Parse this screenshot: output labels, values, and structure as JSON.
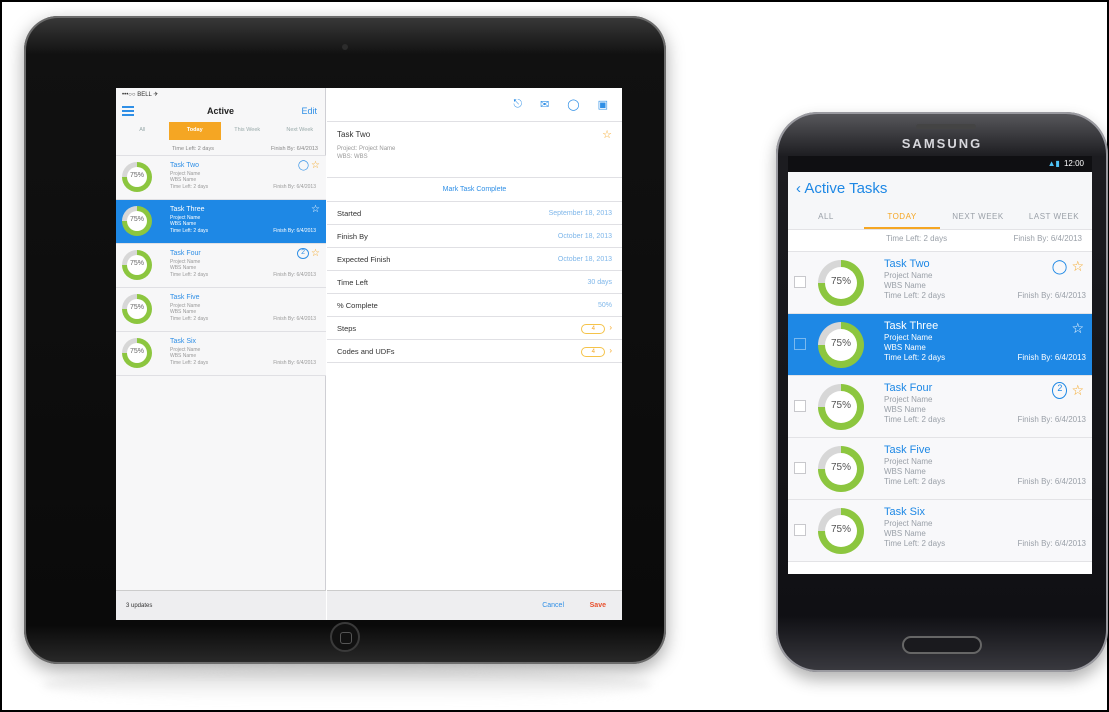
{
  "tablet": {
    "status": "•••○○ BELL ✈",
    "nav_title": "Active",
    "edit_label": "Edit",
    "tabs": [
      "All",
      "Today",
      "This Week",
      "Next Week"
    ],
    "partial_row": {
      "time_left": "Time Left: 2 days",
      "finish_by": "Finish By: 6/4/2013"
    },
    "tasks": [
      {
        "title": "Task Two",
        "project": "Project Name",
        "wbs": "WBS Name",
        "time_left": "Time Left: 2 days",
        "finish_by": "Finish By: 6/4/2013",
        "percent": "75%",
        "badge": "",
        "selected": false
      },
      {
        "title": "Task Three",
        "project": "Project Name",
        "wbs": "WBS Name",
        "time_left": "Time Left: 2 days",
        "finish_by": "Finish By: 6/4/2013",
        "percent": "75%",
        "badge": "",
        "selected": true
      },
      {
        "title": "Task Four",
        "project": "Project Name",
        "wbs": "WBS Name",
        "time_left": "Time Left: 2 days",
        "finish_by": "Finish By: 6/4/2013",
        "percent": "75%",
        "badge": "2",
        "selected": false
      },
      {
        "title": "Task Five",
        "project": "Project Name",
        "wbs": "WBS Name",
        "time_left": "Time Left: 2 days",
        "finish_by": "Finish By: 6/4/2013",
        "percent": "75%",
        "badge": "",
        "selected": false
      },
      {
        "title": "Task Six",
        "project": "Project Name",
        "wbs": "WBS Name",
        "time_left": "Time Left: 2 days",
        "finish_by": "Finish By: 6/4/2013",
        "percent": "75%",
        "badge": "",
        "selected": false
      }
    ],
    "footer": "3 updates",
    "detail": {
      "title": "Task Two",
      "project_label": "Project:",
      "project_value": "Project Name",
      "wbs_label": "WBS:",
      "wbs_value": "WBS",
      "mark_complete": "Mark Task Complete",
      "fields": [
        {
          "label": "Started",
          "value": "September 18, 2013",
          "pill": ""
        },
        {
          "label": "Finish By",
          "value": "October 18, 2013",
          "pill": ""
        },
        {
          "label": "Expected Finish",
          "value": "October 18, 2013",
          "pill": ""
        },
        {
          "label": "Time Left",
          "value": "30 days",
          "pill": ""
        },
        {
          "label": "% Complete",
          "value": "50%",
          "pill": ""
        },
        {
          "label": "Steps",
          "value": "",
          "pill": "4"
        },
        {
          "label": "Codes and UDFs",
          "value": "",
          "pill": "4"
        }
      ],
      "cancel": "Cancel",
      "save": "Save"
    }
  },
  "phone": {
    "brand": "SAMSUNG",
    "time": "12:00",
    "back_title": "‹ Active Tasks",
    "tabs": [
      "ALL",
      "TODAY",
      "NEXT WEEK",
      "LAST WEEK"
    ],
    "active_tab": "TODAY",
    "partial_row": {
      "time_left": "Time Left: 2 days",
      "finish_by": "Finish By: 6/4/2013"
    },
    "tasks": [
      {
        "title": "Task Two",
        "project": "Project Name",
        "wbs": "WBS Name",
        "time_left": "Time Left: 2 days",
        "finish_by": "Finish By: 6/4/2013",
        "percent": "75%"
      },
      {
        "title": "Task Three",
        "project": "Project Name",
        "wbs": "WBS Name",
        "time_left": "Time Left: 2 days",
        "finish_by": "Finish By: 6/4/2013",
        "percent": "75%"
      },
      {
        "title": "Task Four",
        "project": "Project Name",
        "wbs": "WBS Name",
        "time_left": "Time Left: 2 days",
        "finish_by": "Finish By: 6/4/2013",
        "percent": "75%"
      },
      {
        "title": "Task Five",
        "project": "Project Name",
        "wbs": "WBS Name",
        "time_left": "Time Left: 2 days",
        "finish_by": "Finish By: 6/4/2013",
        "percent": "75%"
      },
      {
        "title": "Task Six",
        "project": "Project Name",
        "wbs": "WBS Name",
        "time_left": "Time Left: 2 days",
        "finish_by": "Finish By: 6/4/2013",
        "percent": "75%"
      }
    ]
  },
  "colors": {
    "accent_blue": "#1e88e5",
    "accent_orange": "#f5a623",
    "progress_green": "#8cc63f"
  }
}
